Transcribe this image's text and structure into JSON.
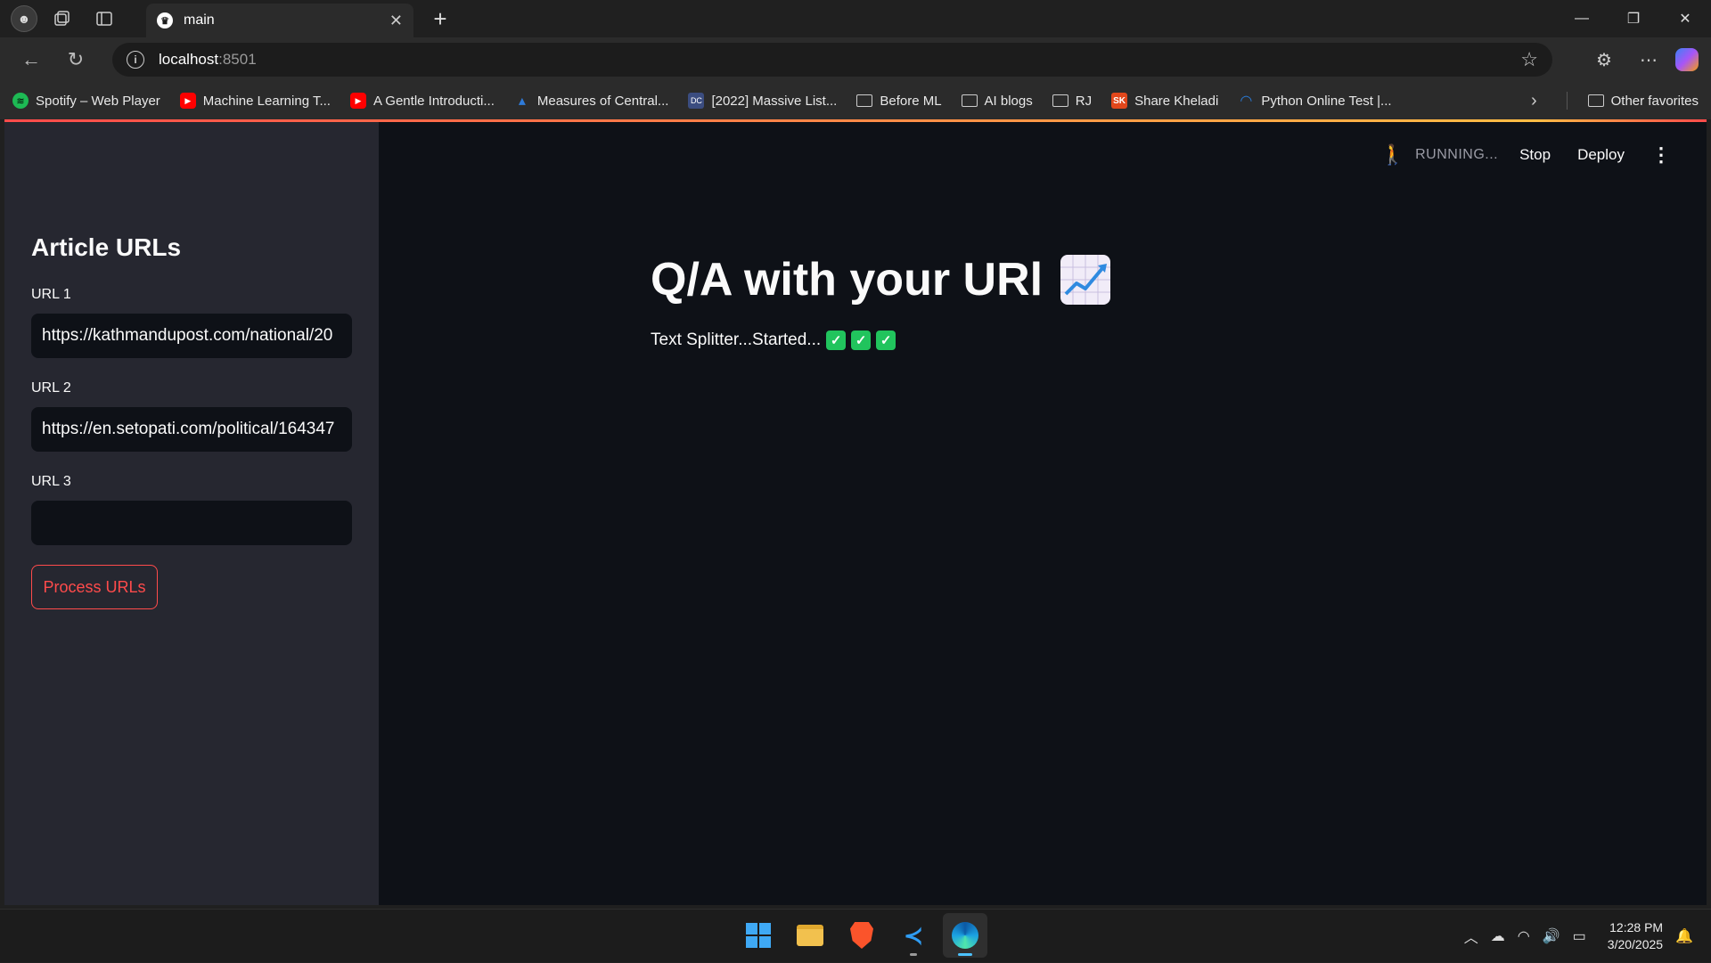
{
  "browser": {
    "tab_title": "main",
    "url_host": "localhost",
    "url_port": ":8501",
    "bookmarks": [
      {
        "label": "Spotify – Web Player",
        "icon": "spotify-icon"
      },
      {
        "label": "Machine Learning T...",
        "icon": "youtube-icon"
      },
      {
        "label": "A Gentle Introducti...",
        "icon": "youtube-icon"
      },
      {
        "label": "Measures of Central...",
        "icon": "drop-icon"
      },
      {
        "label": "[2022] Massive List...",
        "icon": "dc-icon"
      },
      {
        "label": "Before ML",
        "icon": "folder-icon"
      },
      {
        "label": "AI blogs",
        "icon": "folder-icon"
      },
      {
        "label": "RJ",
        "icon": "folder-icon"
      },
      {
        "label": "Share Kheladi",
        "icon": "sk-icon"
      },
      {
        "label": "Python Online Test |...",
        "icon": "python-icon"
      }
    ],
    "other_favorites": "Other favorites"
  },
  "app": {
    "toolbar": {
      "running_label": "RUNNING...",
      "stop_label": "Stop",
      "deploy_label": "Deploy"
    },
    "sidebar": {
      "title": "Article URLs",
      "fields": [
        {
          "label": "URL 1",
          "value": "https://kathmandupost.com/national/20"
        },
        {
          "label": "URL 2",
          "value": "https://en.setopati.com/political/164347"
        },
        {
          "label": "URL 3",
          "value": ""
        }
      ],
      "process_button": "Process URLs"
    },
    "main": {
      "title": "Q/A with your URl",
      "status": "Text Splitter...Started..."
    },
    "colors": {
      "accent": "#ff4b4b",
      "background": "#0e1117",
      "sidebar": "#262730",
      "check": "#21c45d"
    }
  },
  "taskbar": {
    "time": "12:28 PM",
    "date": "3/20/2025"
  }
}
